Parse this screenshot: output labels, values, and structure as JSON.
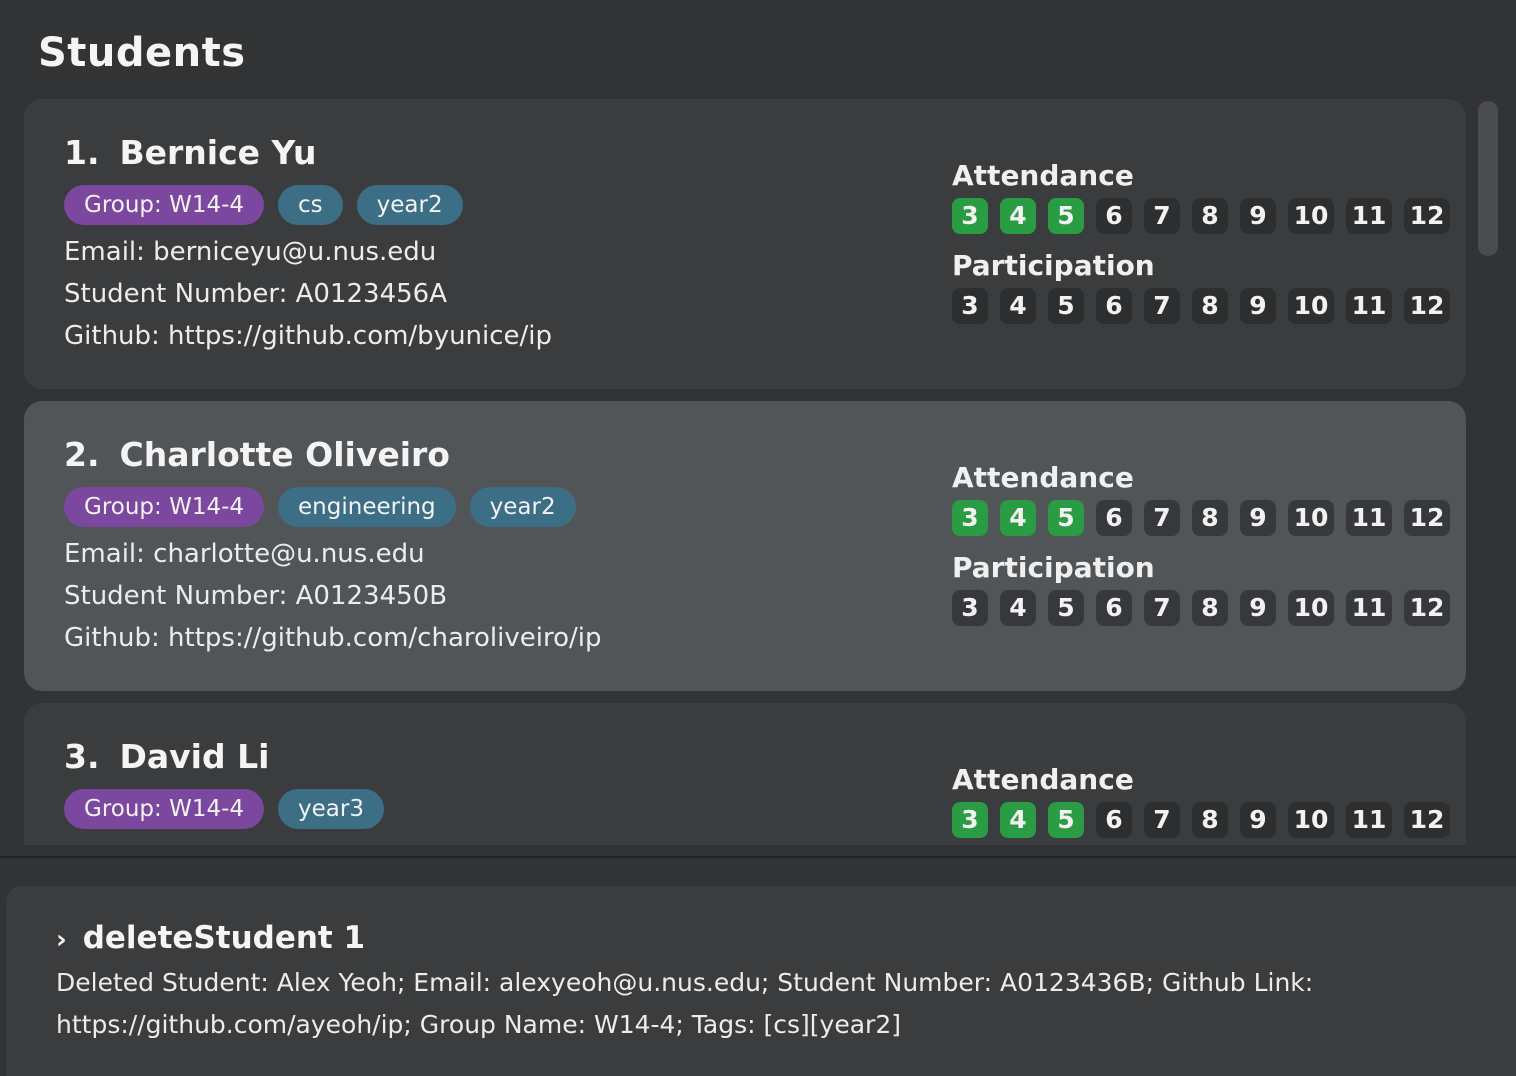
{
  "panel_title": "Students",
  "students": [
    {
      "index": "1.",
      "name": "Bernice Yu",
      "tags": [
        {
          "label": "Group: W14-4",
          "kind": "group"
        },
        {
          "label": "cs",
          "kind": "tag"
        },
        {
          "label": "year2",
          "kind": "tag"
        }
      ],
      "email": "Email: berniceyu@u.nus.edu",
      "student_number": "Student Number: A0123456A",
      "github": "Github: https://github.com/byunice/ip",
      "selected": false,
      "attendance_label": "Attendance",
      "participation_label": "Participation",
      "attendance": [
        {
          "week": "3",
          "marked": true
        },
        {
          "week": "4",
          "marked": true
        },
        {
          "week": "5",
          "marked": true
        },
        {
          "week": "6",
          "marked": false
        },
        {
          "week": "7",
          "marked": false
        },
        {
          "week": "8",
          "marked": false
        },
        {
          "week": "9",
          "marked": false
        },
        {
          "week": "10",
          "marked": false
        },
        {
          "week": "11",
          "marked": false
        },
        {
          "week": "12",
          "marked": false
        }
      ],
      "participation": [
        {
          "week": "3",
          "marked": false
        },
        {
          "week": "4",
          "marked": false
        },
        {
          "week": "5",
          "marked": false
        },
        {
          "week": "6",
          "marked": false
        },
        {
          "week": "7",
          "marked": false
        },
        {
          "week": "8",
          "marked": false
        },
        {
          "week": "9",
          "marked": false
        },
        {
          "week": "10",
          "marked": false
        },
        {
          "week": "11",
          "marked": false
        },
        {
          "week": "12",
          "marked": false
        }
      ]
    },
    {
      "index": "2.",
      "name": "Charlotte Oliveiro",
      "tags": [
        {
          "label": "Group: W14-4",
          "kind": "group"
        },
        {
          "label": "engineering",
          "kind": "tag"
        },
        {
          "label": "year2",
          "kind": "tag"
        }
      ],
      "email": "Email: charlotte@u.nus.edu",
      "student_number": "Student Number: A0123450B",
      "github": "Github: https://github.com/charoliveiro/ip",
      "selected": true,
      "attendance_label": "Attendance",
      "participation_label": "Participation",
      "attendance": [
        {
          "week": "3",
          "marked": true
        },
        {
          "week": "4",
          "marked": true
        },
        {
          "week": "5",
          "marked": true
        },
        {
          "week": "6",
          "marked": false
        },
        {
          "week": "7",
          "marked": false
        },
        {
          "week": "8",
          "marked": false
        },
        {
          "week": "9",
          "marked": false
        },
        {
          "week": "10",
          "marked": false
        },
        {
          "week": "11",
          "marked": false
        },
        {
          "week": "12",
          "marked": false
        }
      ],
      "participation": [
        {
          "week": "3",
          "marked": false
        },
        {
          "week": "4",
          "marked": false
        },
        {
          "week": "5",
          "marked": false
        },
        {
          "week": "6",
          "marked": false
        },
        {
          "week": "7",
          "marked": false
        },
        {
          "week": "8",
          "marked": false
        },
        {
          "week": "9",
          "marked": false
        },
        {
          "week": "10",
          "marked": false
        },
        {
          "week": "11",
          "marked": false
        },
        {
          "week": "12",
          "marked": false
        }
      ]
    },
    {
      "index": "3.",
      "name": "David Li",
      "tags": [
        {
          "label": "Group: W14-4",
          "kind": "group"
        },
        {
          "label": "year3",
          "kind": "tag"
        }
      ],
      "email": "",
      "student_number": "",
      "github": "",
      "selected": false,
      "attendance_label": "Attendance",
      "participation_label": "",
      "attendance": [
        {
          "week": "3",
          "marked": true
        },
        {
          "week": "4",
          "marked": true
        },
        {
          "week": "5",
          "marked": true
        },
        {
          "week": "6",
          "marked": false
        },
        {
          "week": "7",
          "marked": false
        },
        {
          "week": "8",
          "marked": false
        },
        {
          "week": "9",
          "marked": false
        },
        {
          "week": "10",
          "marked": false
        },
        {
          "week": "11",
          "marked": false
        },
        {
          "week": "12",
          "marked": false
        }
      ],
      "participation": []
    }
  ],
  "command": {
    "prompt_icon": "chevron-right-icon",
    "prompt_glyph": "›",
    "text": "deleteStudent 1"
  },
  "result": {
    "line1": "Deleted Student: Alex Yeoh; Email: alexyeoh@u.nus.edu; Student Number: A0123436B; Github Link:",
    "line2": "https://github.com/ayeoh/ip; Group Name: W14-4; Tags: [cs][year2]"
  },
  "colors": {
    "background": "#323334",
    "card": "#3b3c3e",
    "card_selected": "#515558",
    "group_tag": "#7b479f",
    "tag": "#3c6e86",
    "week_marked": "#2a9c43",
    "week_unmarked": "#2d2e30"
  }
}
